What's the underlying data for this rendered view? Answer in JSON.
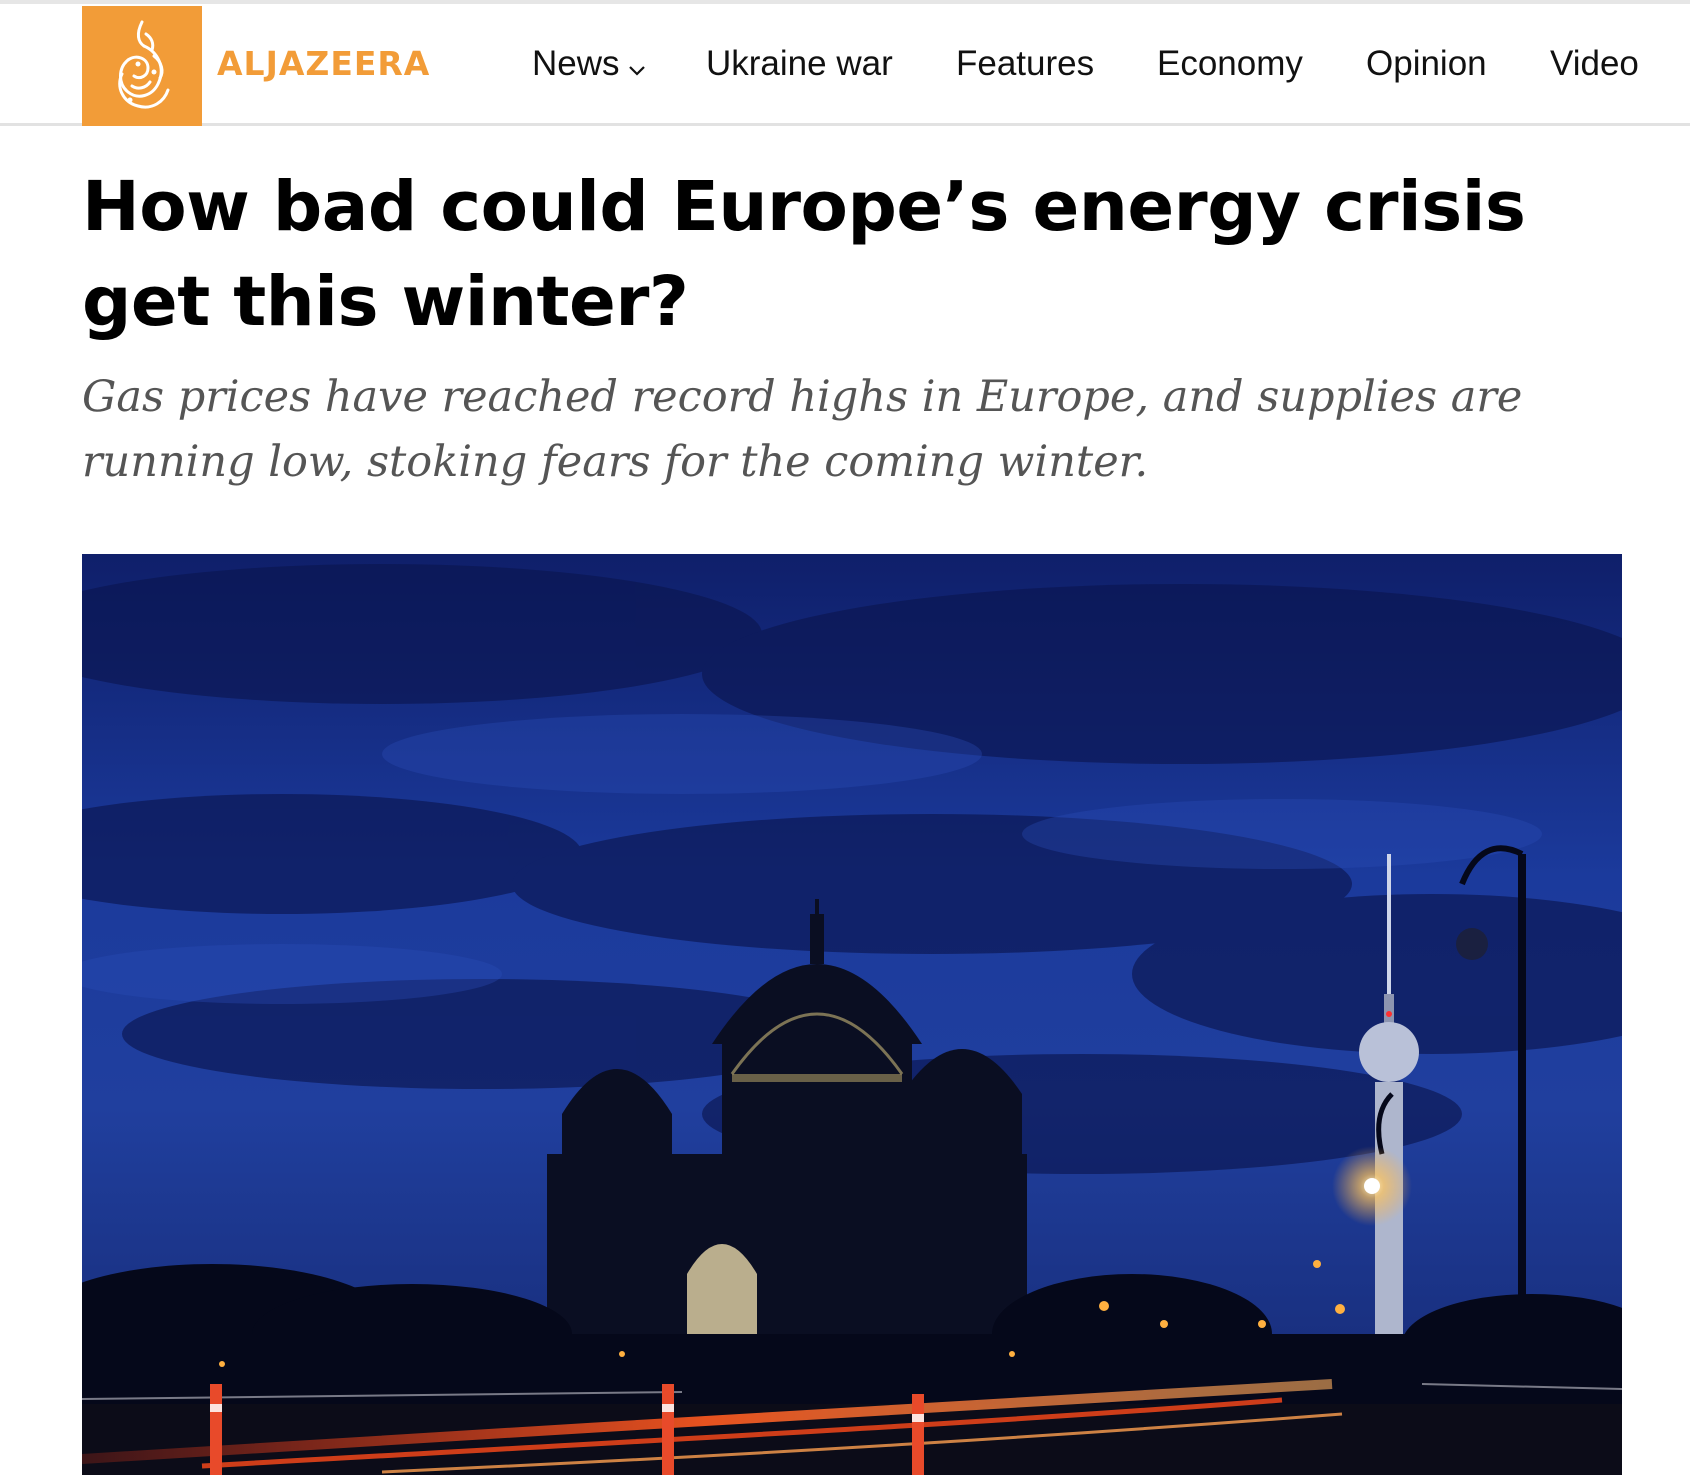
{
  "site": {
    "brand": "ALJAZEERA",
    "accent_color": "#f29c38"
  },
  "nav": {
    "items": [
      {
        "label": "News",
        "has_dropdown": true
      },
      {
        "label": "Ukraine war"
      },
      {
        "label": "Features"
      },
      {
        "label": "Economy"
      },
      {
        "label": "Opinion"
      },
      {
        "label": "Video"
      }
    ],
    "dropdown_icon": "chevron-down-icon"
  },
  "article": {
    "headline": "How bad could Europe’s energy crisis get this winter?",
    "subheadline": "Gas prices have reached record highs in Europe, and supplies are running low, stoking fears for the coming winter."
  }
}
